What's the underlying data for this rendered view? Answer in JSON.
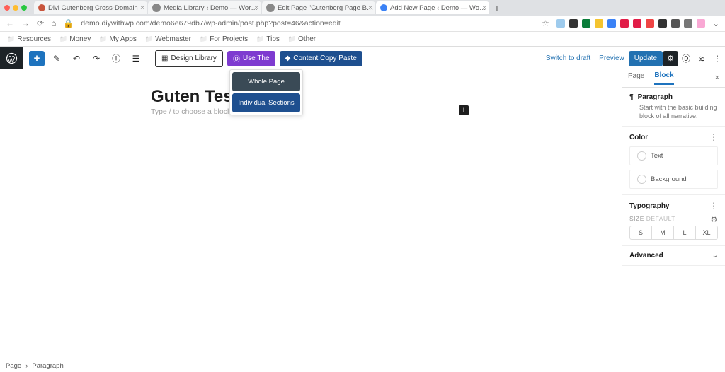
{
  "browser": {
    "tabs": [
      {
        "label": "Divi Gutenberg Cross-Domain"
      },
      {
        "label": "Media Library ‹ Demo — Wor…"
      },
      {
        "label": "Edit Page \"Gutenberg Page B…"
      },
      {
        "label": "Add New Page ‹ Demo — Wo…"
      }
    ],
    "active_tab_index": 3,
    "url": "demo.diywithwp.com/demo6e679db7/wp-admin/post.php?post=46&action=edit",
    "bookmarks": [
      "Resources",
      "Money",
      "My Apps",
      "Webmaster",
      "For Projects",
      "Tips",
      "Other"
    ]
  },
  "header": {
    "design_library": "Design Library",
    "use_the": "Use The",
    "content_copy_paste": "Content Copy Paste",
    "switch_to_draft": "Switch to draft",
    "preview": "Preview",
    "update": "Update"
  },
  "dropdown": {
    "whole_page": "Whole Page",
    "individual_sections": "Individual Sections"
  },
  "canvas": {
    "title": "Guten Test",
    "placeholder": "Type / to choose a block"
  },
  "sidebar": {
    "tabs": {
      "page": "Page",
      "block": "Block"
    },
    "block": {
      "name": "Paragraph",
      "desc": "Start with the basic building block of all narrative."
    },
    "color": {
      "title": "Color",
      "text": "Text",
      "background": "Background"
    },
    "typography": {
      "title": "Typography",
      "size_label": "SIZE",
      "size_default": "DEFAULT",
      "sizes": [
        "S",
        "M",
        "L",
        "XL"
      ]
    },
    "advanced": "Advanced"
  },
  "breadcrumb": {
    "a": "Page",
    "b": "Paragraph"
  }
}
